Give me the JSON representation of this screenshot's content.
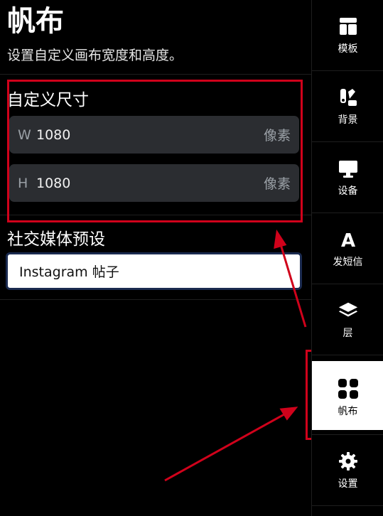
{
  "header": {
    "title": "帆布",
    "subtitle": "设置自定义画布宽度和高度。"
  },
  "custom_size": {
    "title": "自定义尺寸",
    "width": {
      "prefix": "W",
      "value": "1080",
      "unit": "像素"
    },
    "height": {
      "prefix": "H",
      "value": "1080",
      "unit": "像素"
    }
  },
  "social_preset": {
    "title": "社交媒体预设",
    "selected": "Instagram 帖子"
  },
  "sidebar": {
    "items": [
      {
        "label": "模板",
        "icon": "template-icon"
      },
      {
        "label": "背景",
        "icon": "background-icon"
      },
      {
        "label": "设备",
        "icon": "monitor-icon"
      },
      {
        "label": "发短信",
        "icon": "text-icon"
      },
      {
        "label": "层",
        "icon": "layers-icon"
      },
      {
        "label": "帆布",
        "icon": "grid-icon",
        "active": true
      },
      {
        "label": "设置",
        "icon": "gear-icon"
      }
    ]
  },
  "colors": {
    "annotation_red": "#d0021b",
    "field_bg": "#2b2d31",
    "select_border": "#1a2a4f"
  }
}
